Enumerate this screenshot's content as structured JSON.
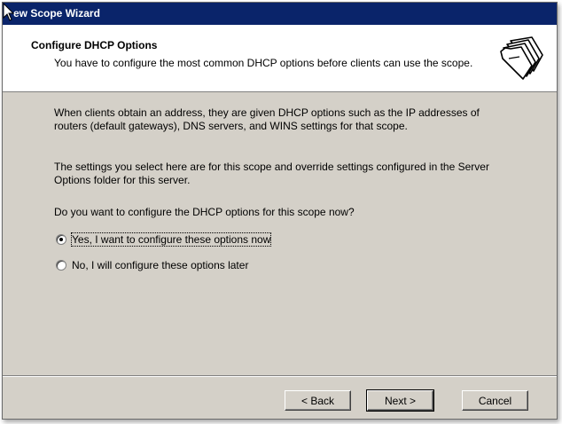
{
  "window": {
    "title": "ew Scope Wizard"
  },
  "header": {
    "title": "Configure DHCP Options",
    "subtitle": "You have to configure the most common DHCP options before clients can use the scope.",
    "icon": "folders-icon"
  },
  "body": {
    "paragraph1": "When clients obtain an address, they are given DHCP options such as the IP addresses of routers (default gateways), DNS servers, and WINS settings for that scope.",
    "paragraph2": "The settings you select here are for this scope and override settings configured in the Server Options folder for this server.",
    "question": "Do you want to configure the DHCP options for this scope now?",
    "options": [
      {
        "label": "Yes, I want to configure these options now",
        "selected": true
      },
      {
        "label": "No, I will configure these options later",
        "selected": false
      }
    ]
  },
  "buttons": {
    "back": "< Back",
    "next": "Next >",
    "cancel": "Cancel"
  }
}
